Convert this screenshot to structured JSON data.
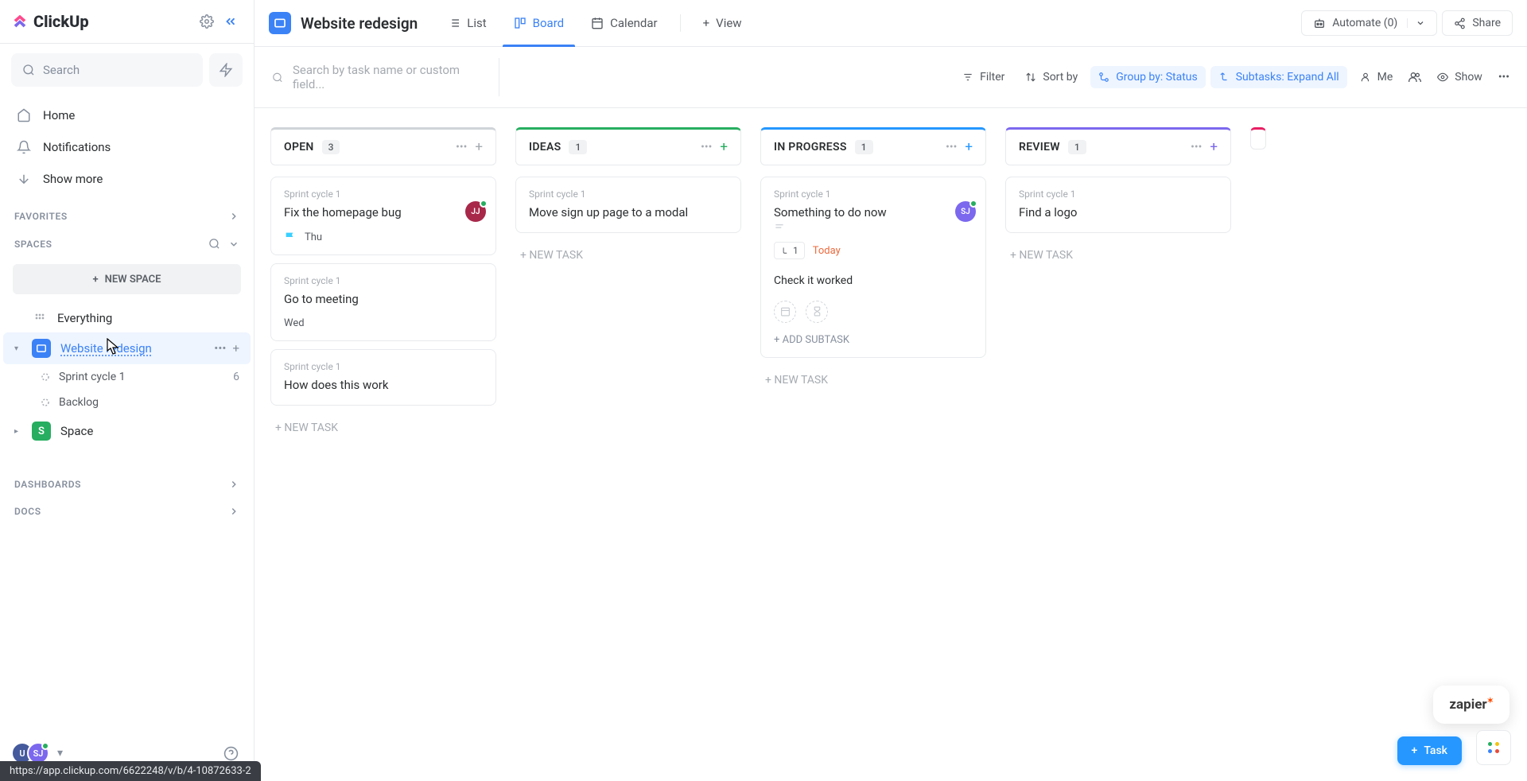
{
  "logo_text": "ClickUp",
  "search_placeholder": "Search",
  "nav": {
    "home": "Home",
    "notifications": "Notifications",
    "show_more": "Show more"
  },
  "sections": {
    "favorites": "FAVORITES",
    "spaces": "SPACES",
    "dashboards": "DASHBOARDS",
    "docs": "DOCS"
  },
  "new_space": "NEW SPACE",
  "spaces": {
    "everything": "Everything",
    "website": "Website redesign",
    "sprint": {
      "name": "Sprint cycle 1",
      "count": "6"
    },
    "backlog": "Backlog",
    "space": "Space",
    "space_initial": "S"
  },
  "header": {
    "title": "Website redesign",
    "list": "List",
    "board": "Board",
    "calendar": "Calendar",
    "view": "View",
    "automate": "Automate (0)",
    "share": "Share"
  },
  "toolbar": {
    "search_placeholder": "Search by task name or custom field...",
    "filter": "Filter",
    "sort": "Sort by",
    "group": "Group by: Status",
    "subtasks": "Subtasks: Expand All",
    "me": "Me",
    "show": "Show"
  },
  "columns": {
    "open": {
      "name": "OPEN",
      "count": "3",
      "color": "#d0d4d9",
      "plus_color": "#a6abb1"
    },
    "ideas": {
      "name": "IDEAS",
      "count": "1",
      "color": "#27ae60",
      "plus_color": "#27ae60"
    },
    "progress": {
      "name": "IN PROGRESS",
      "count": "1",
      "color": "#2597ff",
      "plus_color": "#2597ff"
    },
    "review": {
      "name": "REVIEW",
      "count": "1",
      "color": "#7b68ee",
      "plus_color": "#7b68ee"
    }
  },
  "cards": {
    "breadcrumb": "Sprint cycle 1",
    "open1": {
      "title": "Fix the homepage bug",
      "due": "Thu"
    },
    "open2": {
      "title": "Go to meeting",
      "due": "Wed"
    },
    "open3": {
      "title": "How does this work"
    },
    "ideas1": {
      "title": "Move sign up page to a modal"
    },
    "prog1": {
      "title": "Something to do now",
      "sub_count": "1",
      "due": "Today",
      "subtask": "Check it worked"
    },
    "review1": {
      "title": "Find a logo"
    }
  },
  "new_task": "+ NEW TASK",
  "add_subtask": "+ ADD SUBTASK",
  "fab": {
    "task": "Task",
    "zapier": "zapier"
  },
  "avatars": {
    "u": "U",
    "sj": "SJ"
  },
  "url": "https://app.clickup.com/6622248/v/b/4-10872633-2"
}
